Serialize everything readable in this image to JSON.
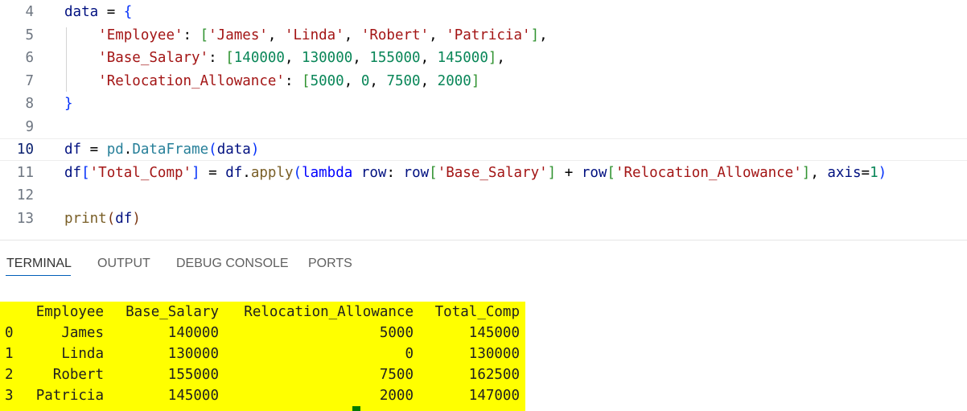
{
  "editor": {
    "lines": [
      {
        "number": "4",
        "tokens": [
          [
            "t-var",
            "data"
          ],
          [
            "t-op",
            " = "
          ],
          [
            "t-br1",
            "{"
          ]
        ]
      },
      {
        "number": "5",
        "tokens": [
          [
            "t-op",
            "    "
          ],
          [
            "t-str",
            "'Employee'"
          ],
          [
            "t-op",
            ": "
          ],
          [
            "t-br2",
            "["
          ],
          [
            "t-str",
            "'James'"
          ],
          [
            "t-op",
            ", "
          ],
          [
            "t-str",
            "'Linda'"
          ],
          [
            "t-op",
            ", "
          ],
          [
            "t-str",
            "'Robert'"
          ],
          [
            "t-op",
            ", "
          ],
          [
            "t-str",
            "'Patricia'"
          ],
          [
            "t-br2",
            "]"
          ],
          [
            "t-op",
            ","
          ]
        ]
      },
      {
        "number": "6",
        "tokens": [
          [
            "t-op",
            "    "
          ],
          [
            "t-str",
            "'Base_Salary'"
          ],
          [
            "t-op",
            ": "
          ],
          [
            "t-br2",
            "["
          ],
          [
            "t-num",
            "140000"
          ],
          [
            "t-op",
            ", "
          ],
          [
            "t-num",
            "130000"
          ],
          [
            "t-op",
            ", "
          ],
          [
            "t-num",
            "155000"
          ],
          [
            "t-op",
            ", "
          ],
          [
            "t-num",
            "145000"
          ],
          [
            "t-br2",
            "]"
          ],
          [
            "t-op",
            ","
          ]
        ]
      },
      {
        "number": "7",
        "tokens": [
          [
            "t-op",
            "    "
          ],
          [
            "t-str",
            "'Relocation_Allowance'"
          ],
          [
            "t-op",
            ": "
          ],
          [
            "t-br2",
            "["
          ],
          [
            "t-num",
            "5000"
          ],
          [
            "t-op",
            ", "
          ],
          [
            "t-num",
            "0"
          ],
          [
            "t-op",
            ", "
          ],
          [
            "t-num",
            "7500"
          ],
          [
            "t-op",
            ", "
          ],
          [
            "t-num",
            "2000"
          ],
          [
            "t-br2",
            "]"
          ]
        ]
      },
      {
        "number": "8",
        "tokens": [
          [
            "t-br1",
            "}"
          ]
        ]
      },
      {
        "number": "9",
        "tokens": []
      },
      {
        "number": "10",
        "tokens": [
          [
            "t-var",
            "df"
          ],
          [
            "t-op",
            " = "
          ],
          [
            "t-cls",
            "pd"
          ],
          [
            "t-op",
            "."
          ],
          [
            "t-cls",
            "DataFrame"
          ],
          [
            "t-br1",
            "("
          ],
          [
            "t-var",
            "data"
          ],
          [
            "t-br1",
            ")"
          ]
        ]
      },
      {
        "number": "11",
        "tokens": [
          [
            "t-var",
            "df"
          ],
          [
            "t-br1",
            "["
          ],
          [
            "t-str",
            "'Total_Comp'"
          ],
          [
            "t-br1",
            "]"
          ],
          [
            "t-op",
            " = "
          ],
          [
            "t-var",
            "df"
          ],
          [
            "t-op",
            "."
          ],
          [
            "t-fn",
            "apply"
          ],
          [
            "t-br1",
            "("
          ],
          [
            "t-kw",
            "lambda"
          ],
          [
            "t-op",
            " "
          ],
          [
            "t-var",
            "row"
          ],
          [
            "t-op",
            ": "
          ],
          [
            "t-var",
            "row"
          ],
          [
            "t-br2",
            "["
          ],
          [
            "t-str",
            "'Base_Salary'"
          ],
          [
            "t-br2",
            "]"
          ],
          [
            "t-op",
            " + "
          ],
          [
            "t-var",
            "row"
          ],
          [
            "t-br2",
            "["
          ],
          [
            "t-str",
            "'Relocation_Allowance'"
          ],
          [
            "t-br2",
            "]"
          ],
          [
            "t-op",
            ", "
          ],
          [
            "t-var",
            "axis"
          ],
          [
            "t-op",
            "="
          ],
          [
            "t-num",
            "1"
          ],
          [
            "t-br1",
            ")"
          ]
        ]
      },
      {
        "number": "12",
        "tokens": []
      },
      {
        "number": "13",
        "tokens": [
          [
            "t-fn",
            "print"
          ],
          [
            "t-br3",
            "("
          ],
          [
            "t-var",
            "df"
          ],
          [
            "t-br3",
            ")"
          ]
        ]
      }
    ],
    "current_line": "10"
  },
  "panel": {
    "tabs": [
      {
        "label": "TERMINAL",
        "active": true
      },
      {
        "label": "OUTPUT",
        "active": false
      },
      {
        "label": "DEBUG CONSOLE",
        "active": false
      },
      {
        "label": "PORTS",
        "active": false
      }
    ],
    "terminal": {
      "header": [
        "",
        "Employee",
        "Base_Salary",
        "Relocation_Allowance",
        "Total_Comp"
      ],
      "rows": [
        [
          "0",
          "James",
          "140000",
          "5000",
          "145000"
        ],
        [
          "1",
          "Linda",
          "130000",
          "0",
          "130000"
        ],
        [
          "2",
          "Robert",
          "155000",
          "7500",
          "162500"
        ],
        [
          "3",
          "Patricia",
          "145000",
          "2000",
          "147000"
        ]
      ],
      "highlight_color": "#ffff00",
      "cursor_color": "#007a00"
    }
  }
}
